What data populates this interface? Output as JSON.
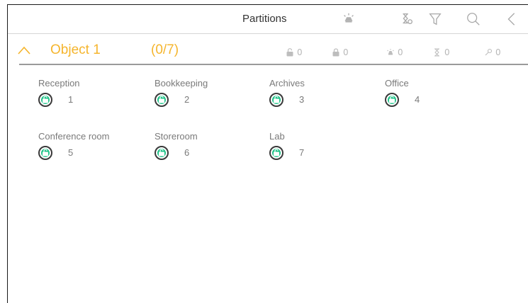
{
  "header": {
    "title": "Partitions",
    "icons": [
      "alarm-bell-icon",
      "hourglass-settings-icon",
      "filter-icon",
      "search-icon",
      "back-chevron-icon"
    ]
  },
  "object": {
    "name": "Object 1",
    "count": "(0/7)",
    "stats": [
      {
        "icon": "unlocked-icon",
        "value": "0"
      },
      {
        "icon": "locked-icon",
        "value": "0"
      },
      {
        "icon": "alarm-icon",
        "value": "0"
      },
      {
        "icon": "hourglass-icon",
        "value": "0"
      },
      {
        "icon": "wrench-icon",
        "value": "0"
      }
    ]
  },
  "partitions": [
    {
      "name": "Reception",
      "number": "1"
    },
    {
      "name": "Bookkeeping",
      "number": "2"
    },
    {
      "name": "Archives",
      "number": "3"
    },
    {
      "name": "Office",
      "number": "4"
    },
    {
      "name": "Conference room",
      "number": "5"
    },
    {
      "name": "Storeroom",
      "number": "6"
    },
    {
      "name": "Lab",
      "number": "7"
    }
  ],
  "colors": {
    "accent": "#f5b52d",
    "status_unarmed": "#22c48a",
    "muted_text": "#7a7a7a",
    "icon_gray": "#aaaaaa"
  }
}
